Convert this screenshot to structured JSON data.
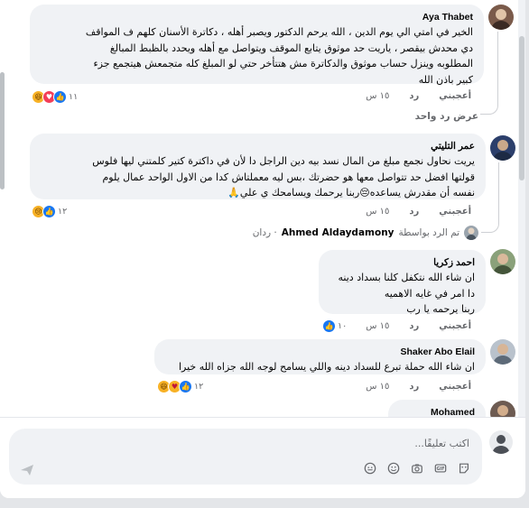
{
  "comments": [
    {
      "author": "Aya Thabet",
      "text": "الخير في امتي الي يوم الدين ، الله يرحم الدكتور ويصبر أهله ، دكاترة الأسنان كلهم ف المواقف\nدي محدش بيقصر ، ياريت حد موثوق يتابع الموقف ويتواصل مع أهله ويحدد بالظبط المبالغ\nالمطلوبه وينزل حساب موثوق والدكاترة مش هتتأخر حتي لو المبلغ كله متجمعش هيتجمع جزء\nكبير باذن الله",
      "time": "١٥ س",
      "like": "أعجبني",
      "reply": "رد",
      "reactions_count": "١١"
    },
    {
      "author": "عمر التليتي",
      "text": "يريت نحاول نجمع مبلغ من المال نسد بيه دين الراجل دا لأن في داكترة كتير كلمتني ليها فلوس\nقولتها افضل حد تتواصل معها هو حضرتك ،بس ليه معملتاش كدا من الاول الواحد عمال يلوم\nنفسه أن مقدرش يساعده😔ربنا يرحمك ويسامحك ي علي🙏",
      "time": "١٥ س",
      "like": "أعجبني",
      "reply": "رد",
      "reactions_count": "١٢"
    },
    {
      "author": "احمد زكريا",
      "text": "ان شاء الله نتكفل كلنا بسداد دينه\nدا امر في غايه الاهميه\nربنا يرحمه يا رب",
      "time": "١٥ س",
      "like": "أعجبني",
      "reply": "رد",
      "reactions_count": "١٠"
    },
    {
      "author": "Shaker Abo Elail",
      "text": "ان شاء الله حملة تبرع للسداد دينه واللي يسامح لوجه الله جزاه الله خيرا",
      "time": "١٥ س",
      "like": "أعجبني",
      "reply": "رد",
      "reactions_count": "١٢"
    },
    {
      "author": "Mohamed Gamal"
    }
  ],
  "view_reply": "عرض رد واحد",
  "replied_by": {
    "prefix": "تم الرد بواسطة",
    "name": "Ahmed Aldaydamony",
    "suffix": "· ردان"
  },
  "composer": {
    "placeholder": "اكتب تعليقًا..."
  },
  "icons": [
    "reply-arrow-icon",
    "like-reaction-icon",
    "love-reaction-icon",
    "care-reaction-icon",
    "haha-reaction-icon",
    "sad-reaction-icon",
    "sticker-icon",
    "gif-icon",
    "camera-icon",
    "emoji-icon",
    "avatar-sticker-icon",
    "send-icon"
  ],
  "colors": {
    "like": "#1877f2",
    "love": "#f33e58",
    "haha": "#f7b125",
    "bubble": "#f0f2f5",
    "meta_text": "#65676b"
  }
}
